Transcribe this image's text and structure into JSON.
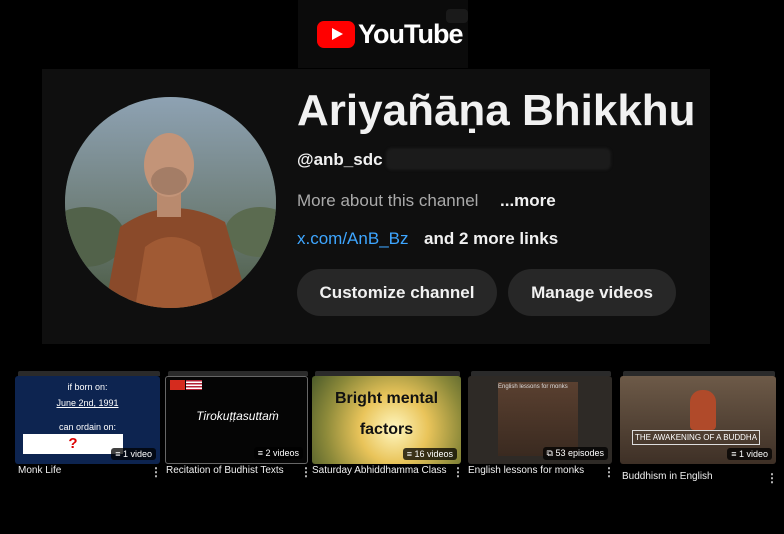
{
  "app": {
    "logo_text": "YouTube"
  },
  "channel": {
    "name": "Ariyañāṇa Bhikkhu",
    "handle": "@anb_sdc",
    "about": "More about this channel",
    "about_more": "...more",
    "link": "x.com/AnB_Bz",
    "link_more": "and 2 more links"
  },
  "actions": {
    "customize": "Customize channel",
    "manage": "Manage videos"
  },
  "playlists": [
    {
      "title": "Monk Life",
      "count": "1 video",
      "thumb_lines": [
        "if born on:",
        "June 2nd, 1991",
        "can ordain on:"
      ],
      "thumb_mark": "?"
    },
    {
      "title": "Recitation of Budhist Texts",
      "count": "2 videos",
      "thumb_text": "Tirokuṭṭasuttaṁ"
    },
    {
      "title": "Saturday Abhiddhamma Class",
      "count": "16 videos",
      "thumb_lines": [
        "Bright mental",
        "factors"
      ]
    },
    {
      "title": "English lessons for monks",
      "count": "53 episodes",
      "thumb_text": "English lessons for monks"
    },
    {
      "title": "Buddhism in English",
      "count": "1 video",
      "thumb_text": "THE AWAKENING OF A BUDDHA"
    }
  ],
  "icons": {
    "kebab": "more-vert-icon",
    "playlist": "playlist-icon",
    "podcast": "podcast-icon"
  },
  "colors": {
    "accent_red": "#ff0000",
    "link_blue": "#3ea6ff",
    "button_bg": "#272727"
  }
}
